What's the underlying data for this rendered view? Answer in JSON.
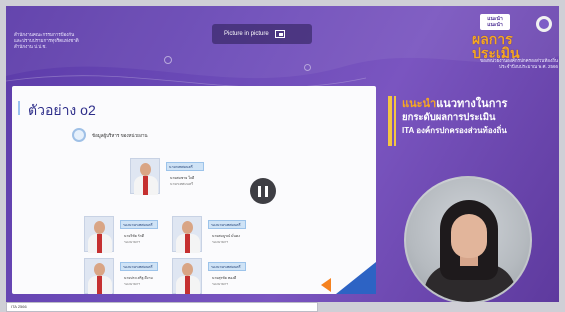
{
  "org": {
    "lines": [
      "สำนักงานคณะกรรมการป้องกัน",
      "และปราบปรามการทุจริตแห่งชาติ",
      "สำนักงาน ป.ป.ช."
    ]
  },
  "pip": {
    "label": "Picture in picture"
  },
  "brand": {
    "logo_text": "แนะนำ แนะนำ",
    "title": "ผลการประเมิน",
    "subtitle_lines": [
      "ของหน่วยงานองค์กรปกครองส่วนท้องถิ่น",
      "ประจำปีงบประมาณ พ.ศ. 2566"
    ]
  },
  "slide": {
    "title": "ตัวอย่าง o2",
    "bullet": "ข้อมูลผู้บริหาร  ของหน่วยงาน",
    "people": [
      {
        "tag": "นายกเทศมนตรี",
        "line1": "นายสมชาย ใจดี",
        "line2": "นายกเทศมนตรี"
      },
      {
        "tag": "รองนายกเทศมนตรี",
        "line1": "นายวิชัย รักดี",
        "line2": "รองนายกฯ"
      },
      {
        "tag": "รองนายกเทศมนตรี",
        "line1": "นายสมบูรณ์ มั่นคง",
        "line2": "รองนายกฯ"
      },
      {
        "tag": "รองนายกเทศมนตรี",
        "line1": "นายประเสริฐ ดีงาม",
        "line2": "รองนายกฯ"
      },
      {
        "tag": "รองนายกเทศมนตรี",
        "line1": "นายสุรชัย ทองดี",
        "line2": "รองนายกฯ"
      }
    ]
  },
  "headline": {
    "line1_accent": "แนะนำ",
    "line1_rest": "แนวทางในการ",
    "line2": "ยกระดับผลการประเมิน",
    "line3": "ITA องค์กรปกครองส่วนท้องถิ่น"
  },
  "caption": {
    "text": "ITA 2566"
  },
  "colors": {
    "accent": "#f5a623",
    "bg": "#6c4bb8",
    "slide_title": "#2e2e8a"
  }
}
